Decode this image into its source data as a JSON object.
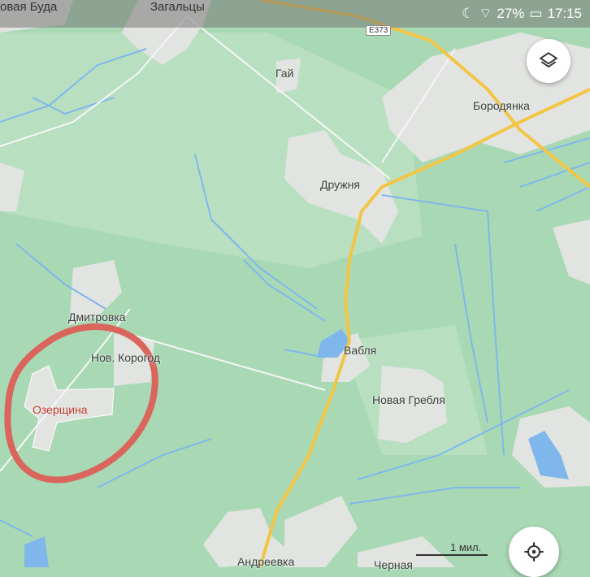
{
  "status_bar": {
    "left_place_1": "овая Буда",
    "left_place_2": "Загальцы",
    "battery": "27%",
    "time": "17:15"
  },
  "map": {
    "places": {
      "gai": "Гай",
      "borodyanka": "Бородянка",
      "druzhnya": "Дружня",
      "dmitrovka": "Дмитровка",
      "nov_korogod": "Нов. Корогод",
      "ozershchina": "Озерщина",
      "vablya": "Вабля",
      "novaya_greblya": "Новая Гребля",
      "andreevka": "Андреевка",
      "chernaya": "Черная"
    },
    "road_shield": "E373",
    "scale_label": "1 мил."
  },
  "controls": {
    "layers_icon": "layers-icon",
    "locate_icon": "my-location-icon"
  },
  "colors": {
    "forest": "#a9d9b4",
    "settlement": "#e2e4e1",
    "water": "#7fb7ec",
    "highway": "#f3c545",
    "annotation": "#d9655c"
  }
}
